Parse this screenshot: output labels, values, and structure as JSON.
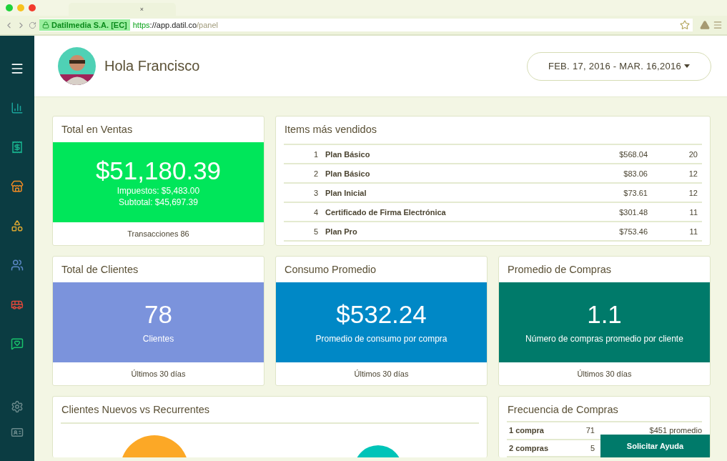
{
  "browser": {
    "tab_close": "×",
    "secure_label": "Datilmedia S.A. [EC]",
    "url": {
      "scheme": "https",
      "rest": "://app.datil.co",
      "path": "/panel"
    }
  },
  "header": {
    "greeting": "Hola Francisco",
    "date_range": "FEB. 17, 2016 - MAR. 16,2016"
  },
  "sales": {
    "title": "Total en Ventas",
    "value": "$51,180.39",
    "lines": [
      "Impuestos: $5,483.00",
      "Subtotal: $45,697.39"
    ],
    "footer": "Transacciones 86",
    "color": "#00e65a"
  },
  "top_items": {
    "title": "Items más vendidos",
    "rows": [
      {
        "rank": "1",
        "name": "Plan Básico",
        "amount": "$568.04",
        "count": "20"
      },
      {
        "rank": "2",
        "name": "Plan Básico",
        "amount": "$83.06",
        "count": "12"
      },
      {
        "rank": "3",
        "name": "Plan Inicial",
        "amount": "$73.61",
        "count": "12"
      },
      {
        "rank": "4",
        "name": "Certificado de Firma Electrónica",
        "amount": "$301.48",
        "count": "11"
      },
      {
        "rank": "5",
        "name": "Plan Pro",
        "amount": "$753.46",
        "count": "11"
      }
    ]
  },
  "stats": [
    {
      "title": "Total de Clientes",
      "value": "78",
      "label": "Clientes",
      "footer": "Últimos 30 días",
      "color": "#7b93dc"
    },
    {
      "title": "Consumo Promedio",
      "value": "$532.24",
      "label": "Promedio de consumo por compra",
      "footer": "Últimos 30 días",
      "color": "#0088c6"
    },
    {
      "title": "Promedio de Compras",
      "value": "1.1",
      "label": "Número de compras promedio por cliente",
      "footer": "Últimos 30 días",
      "color": "#007a6a"
    }
  ],
  "clients_chart": {
    "title": "Clientes Nuevos vs Recurrentes"
  },
  "frequency": {
    "title": "Frecuencia de Compras",
    "rows": [
      {
        "label": "1 compra",
        "count": "71",
        "average": "$451 promedio"
      },
      {
        "label": "2 compras",
        "count": "5"
      }
    ]
  },
  "help_button": "Solicitar Ayuda"
}
